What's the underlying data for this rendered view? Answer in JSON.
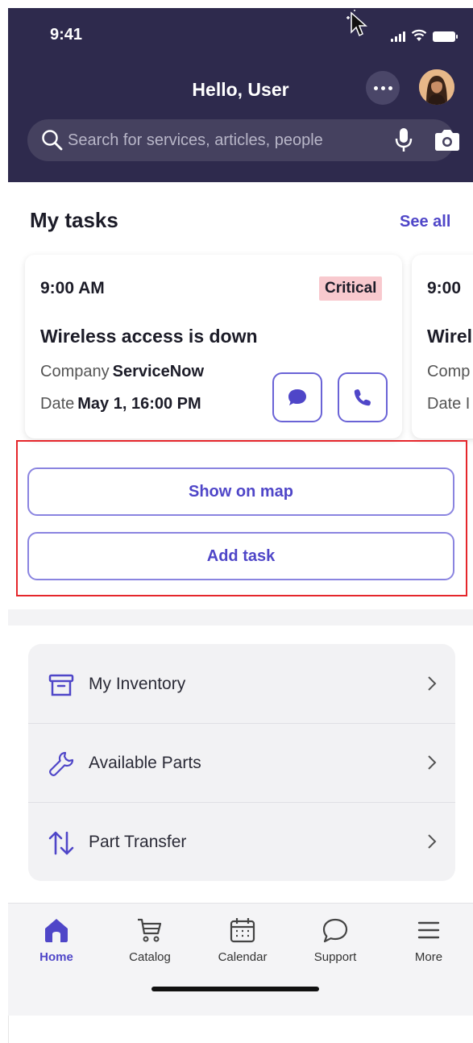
{
  "status_bar": {
    "time": "9:41"
  },
  "header": {
    "greeting": "Hello, User",
    "search_placeholder": "Search for services, articles, people"
  },
  "tasks": {
    "title": "My tasks",
    "see_all": "See all",
    "cards": [
      {
        "time": "9:00 AM",
        "priority": "Critical",
        "title": "Wireless access is down",
        "company_label": "Company",
        "company": "ServiceNow",
        "date_label": "Date",
        "date": "May 1, 16:00 PM"
      },
      {
        "time": "9:00",
        "title": "Wirel",
        "company_label": "Comp",
        "date_label": "Date I"
      }
    ],
    "show_on_map": "Show on map",
    "add_task": "Add task"
  },
  "menu": {
    "items": [
      {
        "label": "My Inventory",
        "icon": "archive-box-icon"
      },
      {
        "label": "Available Parts",
        "icon": "wrench-icon"
      },
      {
        "label": "Part Transfer",
        "icon": "transfer-arrows-icon"
      }
    ]
  },
  "tabbar": {
    "items": [
      {
        "label": "Home",
        "icon": "home-icon",
        "active": true
      },
      {
        "label": "Catalog",
        "icon": "cart-icon"
      },
      {
        "label": "Calendar",
        "icon": "calendar-icon"
      },
      {
        "label": "Support",
        "icon": "chat-bubble-icon"
      },
      {
        "label": "More",
        "icon": "menu-icon"
      }
    ]
  },
  "colors": {
    "header_bg": "#2e2a4d",
    "accent": "#4f46c8",
    "critical_bg": "#f8c9ce",
    "highlight_border": "#e5262b"
  }
}
